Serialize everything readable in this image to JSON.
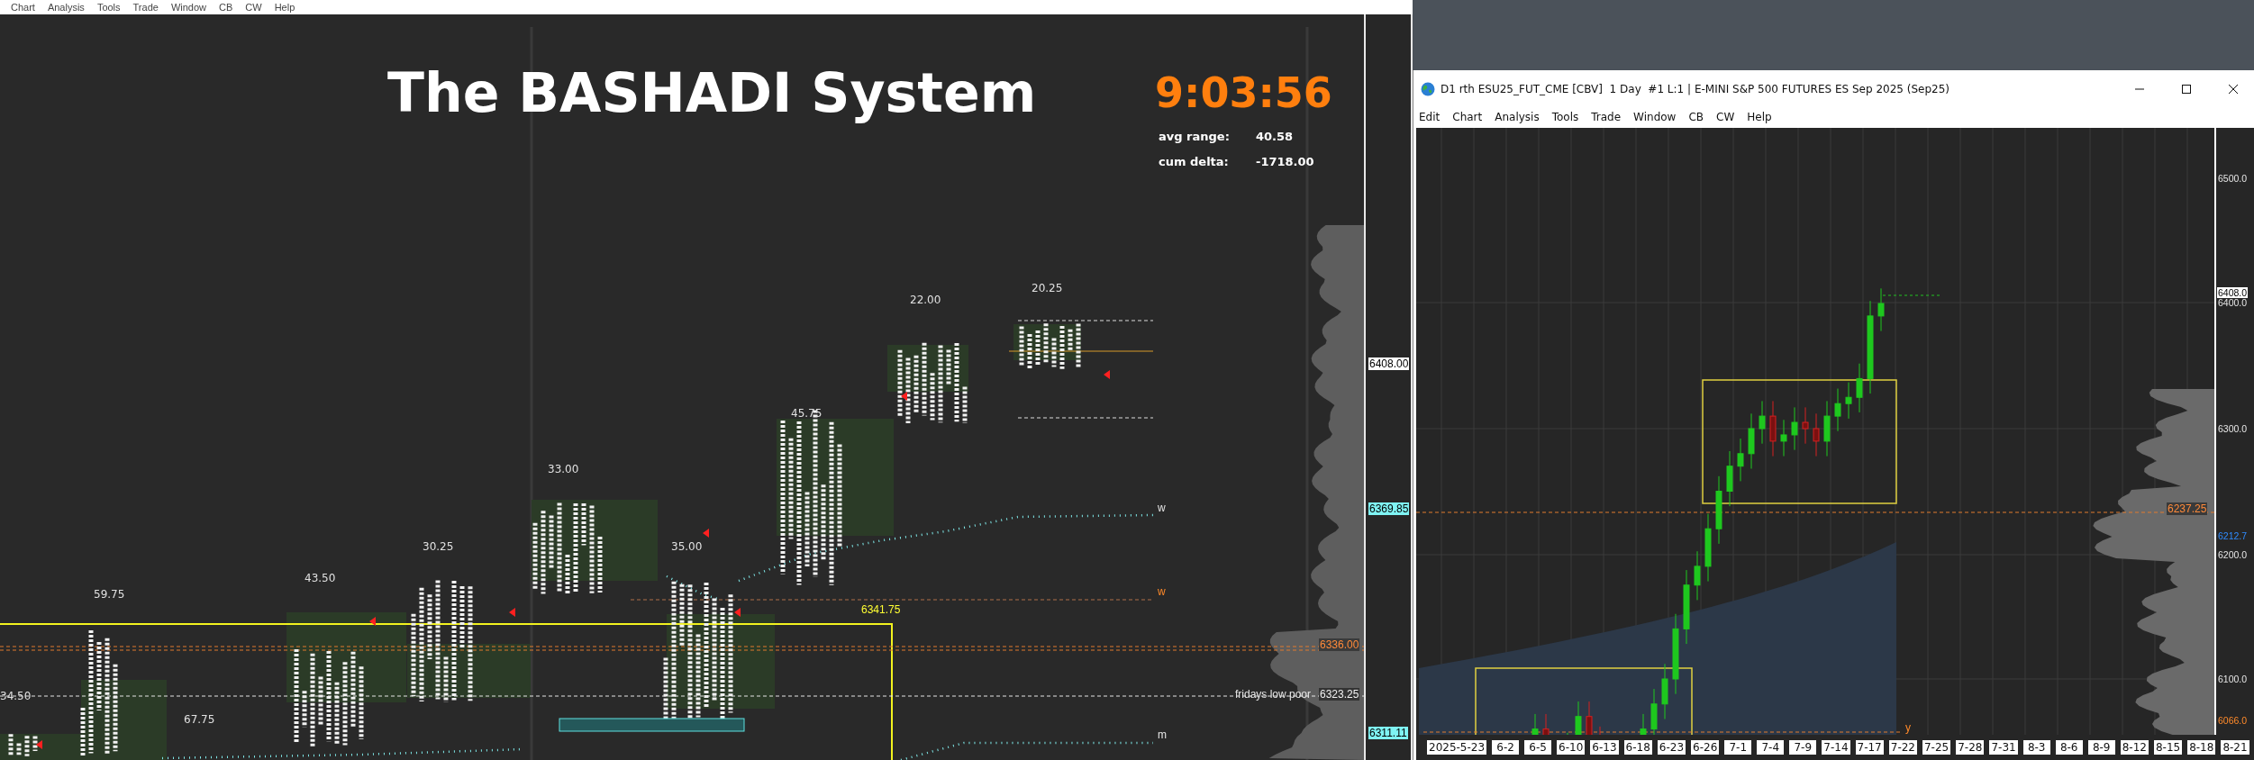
{
  "menu": [
    "Chart",
    "Analysis",
    "Tools",
    "Trade",
    "Window",
    "CB",
    "CW",
    "Help"
  ],
  "left_chart": {
    "title": "The BASHADI System",
    "clock": "9:03:56",
    "stats": [
      {
        "label": "avg range:",
        "value": "40.58"
      },
      {
        "label": "cum delta:",
        "value": "-1718.00"
      }
    ],
    "range_labels": [
      "59.75",
      "34.50",
      "67.75",
      "43.50",
      "30.25",
      "33.00",
      "35.00",
      "45.75",
      "22.00",
      "20.25"
    ],
    "annotations": [
      {
        "kind": "plain",
        "text": "w"
      },
      {
        "kind": "orange",
        "text": "w"
      },
      {
        "kind": "plain",
        "text": "m"
      },
      {
        "kind": "yellow",
        "text": "6341.75"
      },
      {
        "kind": "orange-tag",
        "text": "6336.00"
      },
      {
        "kind": "plain",
        "text": "fridays low poor"
      },
      {
        "kind": "dark-tag",
        "text": "6323.25"
      }
    ],
    "axis_tags": [
      {
        "kind": "white",
        "text": "6408.00"
      },
      {
        "kind": "cyan",
        "text": "6369.85"
      },
      {
        "kind": "cyan",
        "text": "6311.11"
      }
    ]
  },
  "right_window": {
    "title": "D1 rth ESU25_FUT_CME [CBV]  1 Day  #1 L:1 | E-MINI S&P 500 FUTURES ES Sep 2025 (Sep25)",
    "menu": [
      "Edit",
      "Chart",
      "Analysis",
      "Tools",
      "Trade",
      "Window",
      "CB",
      "CW",
      "Help"
    ],
    "y_axis": [
      {
        "kind": "plain",
        "text": "6500.0"
      },
      {
        "kind": "white",
        "text": "6408.0"
      },
      {
        "kind": "plain",
        "text": "6400.0"
      },
      {
        "kind": "plain",
        "text": "6300.0"
      },
      {
        "kind": "blue",
        "text": "6212.7"
      },
      {
        "kind": "plain",
        "text": "6200.0"
      },
      {
        "kind": "plain",
        "text": "6100.0"
      },
      {
        "kind": "orange",
        "text": "6066.0"
      }
    ],
    "annotations": [
      {
        "kind": "orange-tag",
        "text": "6237.25"
      },
      {
        "kind": "orange",
        "text": "y"
      }
    ],
    "x_axis": [
      "2025-5-23",
      "6-2",
      "6-5",
      "6-10",
      "6-13",
      "6-18",
      "6-23",
      "6-26",
      "7-1",
      "7-4",
      "7-9",
      "7-14",
      "7-17",
      "7-22",
      "7-25",
      "7-28",
      "7-31",
      "8-3",
      "8-6",
      "8-9",
      "8-12",
      "8-15",
      "8-18",
      "8-21"
    ]
  }
}
